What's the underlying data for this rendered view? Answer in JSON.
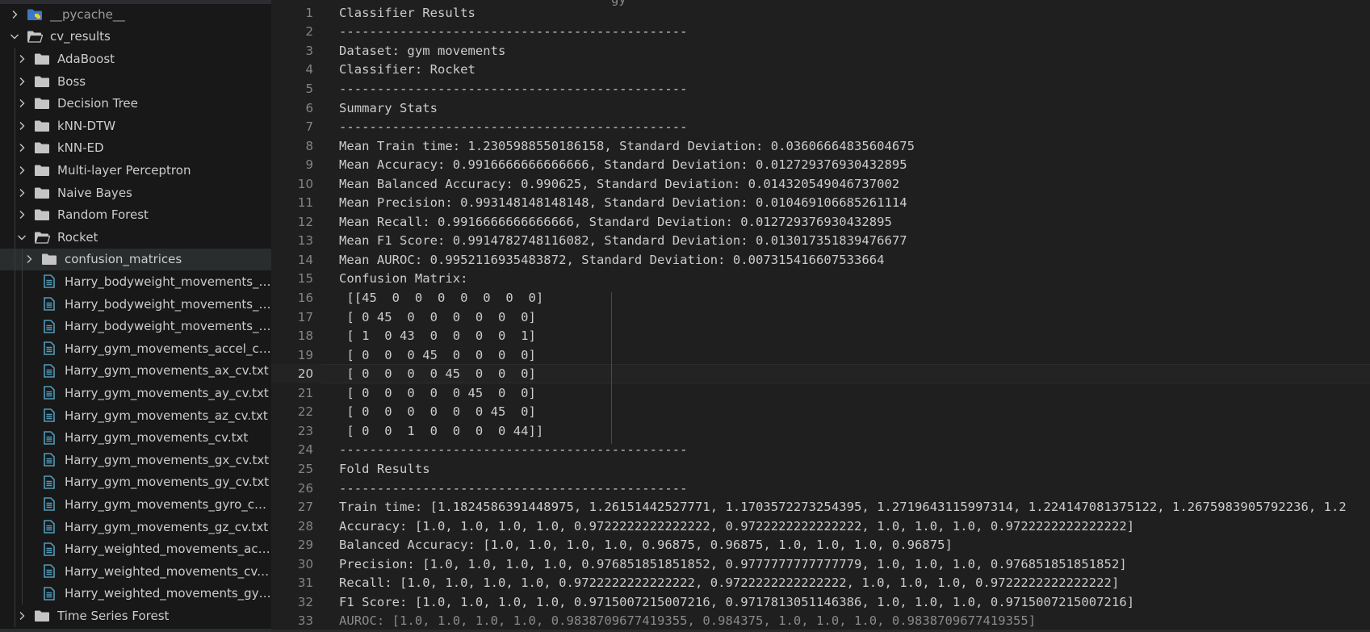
{
  "explorer": {
    "items": [
      {
        "label": "__pycache__",
        "type": "folder-special",
        "state": "collapsed",
        "depth": 0,
        "muted": true
      },
      {
        "label": "cv_results",
        "type": "folder",
        "state": "expanded",
        "depth": 0
      },
      {
        "label": "AdaBoost",
        "type": "folder",
        "state": "collapsed",
        "depth": 1
      },
      {
        "label": "Boss",
        "type": "folder",
        "state": "collapsed",
        "depth": 1
      },
      {
        "label": "Decision Tree",
        "type": "folder",
        "state": "collapsed",
        "depth": 1
      },
      {
        "label": "kNN-DTW",
        "type": "folder",
        "state": "collapsed",
        "depth": 1
      },
      {
        "label": "kNN-ED",
        "type": "folder",
        "state": "collapsed",
        "depth": 1
      },
      {
        "label": "Multi-layer Perceptron",
        "type": "folder",
        "state": "collapsed",
        "depth": 1
      },
      {
        "label": "Naive Bayes",
        "type": "folder",
        "state": "collapsed",
        "depth": 1
      },
      {
        "label": "Random Forest",
        "type": "folder",
        "state": "collapsed",
        "depth": 1
      },
      {
        "label": "Rocket",
        "type": "folder",
        "state": "expanded",
        "depth": 1
      },
      {
        "label": "confusion_matrices",
        "type": "folder",
        "state": "collapsed",
        "depth": 2,
        "selected": true
      },
      {
        "label": "Harry_bodyweight_movements_acc...",
        "type": "file",
        "depth": 2
      },
      {
        "label": "Harry_bodyweight_movements_cv.txt",
        "type": "file",
        "depth": 2
      },
      {
        "label": "Harry_bodyweight_movements_gyr...",
        "type": "file",
        "depth": 2
      },
      {
        "label": "Harry_gym_movements_accel_cv.txt",
        "type": "file",
        "depth": 2
      },
      {
        "label": "Harry_gym_movements_ax_cv.txt",
        "type": "file",
        "depth": 2
      },
      {
        "label": "Harry_gym_movements_ay_cv.txt",
        "type": "file",
        "depth": 2
      },
      {
        "label": "Harry_gym_movements_az_cv.txt",
        "type": "file",
        "depth": 2
      },
      {
        "label": "Harry_gym_movements_cv.txt",
        "type": "file",
        "depth": 2
      },
      {
        "label": "Harry_gym_movements_gx_cv.txt",
        "type": "file",
        "depth": 2
      },
      {
        "label": "Harry_gym_movements_gy_cv.txt",
        "type": "file",
        "depth": 2
      },
      {
        "label": "Harry_gym_movements_gyro_cv.txt",
        "type": "file",
        "depth": 2
      },
      {
        "label": "Harry_gym_movements_gz_cv.txt",
        "type": "file",
        "depth": 2
      },
      {
        "label": "Harry_weighted_movements_accel_...",
        "type": "file",
        "depth": 2
      },
      {
        "label": "Harry_weighted_movements_cv.txt",
        "type": "file",
        "depth": 2
      },
      {
        "label": "Harry_weighted_movements_gyro_...",
        "type": "file",
        "depth": 2
      },
      {
        "label": "Time Series Forest",
        "type": "folder",
        "state": "collapsed",
        "depth": 1
      }
    ]
  },
  "editor": {
    "current_line": 20,
    "top_cut_text": "                        gy",
    "lines": [
      {
        "n": "1",
        "text": "Classifier Results"
      },
      {
        "n": "2",
        "text": "----------------------------------------------"
      },
      {
        "n": "3",
        "text": "Dataset: gym movements"
      },
      {
        "n": "4",
        "text": "Classifier: Rocket"
      },
      {
        "n": "5",
        "text": "----------------------------------------------"
      },
      {
        "n": "6",
        "text": "Summary Stats"
      },
      {
        "n": "7",
        "text": "----------------------------------------------"
      },
      {
        "n": "8",
        "text": "Mean Train time: 1.2305988550186158, Standard Deviation: 0.03606664835604675"
      },
      {
        "n": "9",
        "text": "Mean Accuracy: 0.9916666666666666, Standard Deviation: 0.012729376930432895"
      },
      {
        "n": "10",
        "text": "Mean Balanced Accuracy: 0.990625, Standard Deviation: 0.014320549046737002"
      },
      {
        "n": "11",
        "text": "Mean Precision: 0.993148148148148, Standard Deviation: 0.010469106685261114"
      },
      {
        "n": "12",
        "text": "Mean Recall: 0.9916666666666666, Standard Deviation: 0.012729376930432895"
      },
      {
        "n": "13",
        "text": "Mean F1 Score: 0.9914782748116082, Standard Deviation: 0.013017351839476677"
      },
      {
        "n": "14",
        "text": "Mean AUROC: 0.9952116935483872, Standard Deviation: 0.007315416607533664"
      },
      {
        "n": "15",
        "text": "Confusion Matrix:"
      },
      {
        "n": "16",
        "text": " [[45  0  0  0  0  0  0  0]"
      },
      {
        "n": "17",
        "text": " [ 0 45  0  0  0  0  0  0]"
      },
      {
        "n": "18",
        "text": " [ 1  0 43  0  0  0  0  1]"
      },
      {
        "n": "19",
        "text": " [ 0  0  0 45  0  0  0  0]"
      },
      {
        "n": "20",
        "text": " [ 0  0  0  0 45  0  0  0]"
      },
      {
        "n": "21",
        "text": " [ 0  0  0  0  0 45  0  0]"
      },
      {
        "n": "22",
        "text": " [ 0  0  0  0  0  0 45  0]"
      },
      {
        "n": "23",
        "text": " [ 0  0  1  0  0  0  0 44]]"
      },
      {
        "n": "24",
        "text": "----------------------------------------------"
      },
      {
        "n": "25",
        "text": "Fold Results"
      },
      {
        "n": "26",
        "text": "----------------------------------------------"
      },
      {
        "n": "27",
        "text": "Train time: [1.1824586391448975, 1.26151442527771, 1.1703572273254395, 1.2719643115997314, 1.224147081375122, 1.2675983905792236, 1.2"
      },
      {
        "n": "28",
        "text": "Accuracy: [1.0, 1.0, 1.0, 1.0, 0.9722222222222222, 0.9722222222222222, 1.0, 1.0, 1.0, 0.9722222222222222]"
      },
      {
        "n": "29",
        "text": "Balanced Accuracy: [1.0, 1.0, 1.0, 1.0, 0.96875, 0.96875, 1.0, 1.0, 1.0, 0.96875]"
      },
      {
        "n": "30",
        "text": "Precision: [1.0, 1.0, 1.0, 1.0, 0.976851851851852, 0.9777777777777779, 1.0, 1.0, 1.0, 0.976851851851852]"
      },
      {
        "n": "31",
        "text": "Recall: [1.0, 1.0, 1.0, 1.0, 0.9722222222222222, 0.9722222222222222, 1.0, 1.0, 1.0, 0.9722222222222222]"
      },
      {
        "n": "32",
        "text": "F1 Score: [1.0, 1.0, 1.0, 1.0, 0.9715007215007216, 0.9717813051146386, 1.0, 1.0, 1.0, 0.9715007215007216]"
      },
      {
        "n": "33",
        "text": "AUROC: [1.0, 1.0, 1.0, 1.0, 0.9838709677419355, 0.984375, 1.0, 1.0, 1.0, 0.9838709677419355]"
      }
    ]
  },
  "colors": {
    "sidebar_bg": "#181818",
    "editor_bg": "#1f1f1f",
    "folder_icon": "#c5c5c5",
    "file_icon": "#519aba",
    "python_blue": "#3b78c4",
    "python_yellow": "#f0c93a"
  }
}
